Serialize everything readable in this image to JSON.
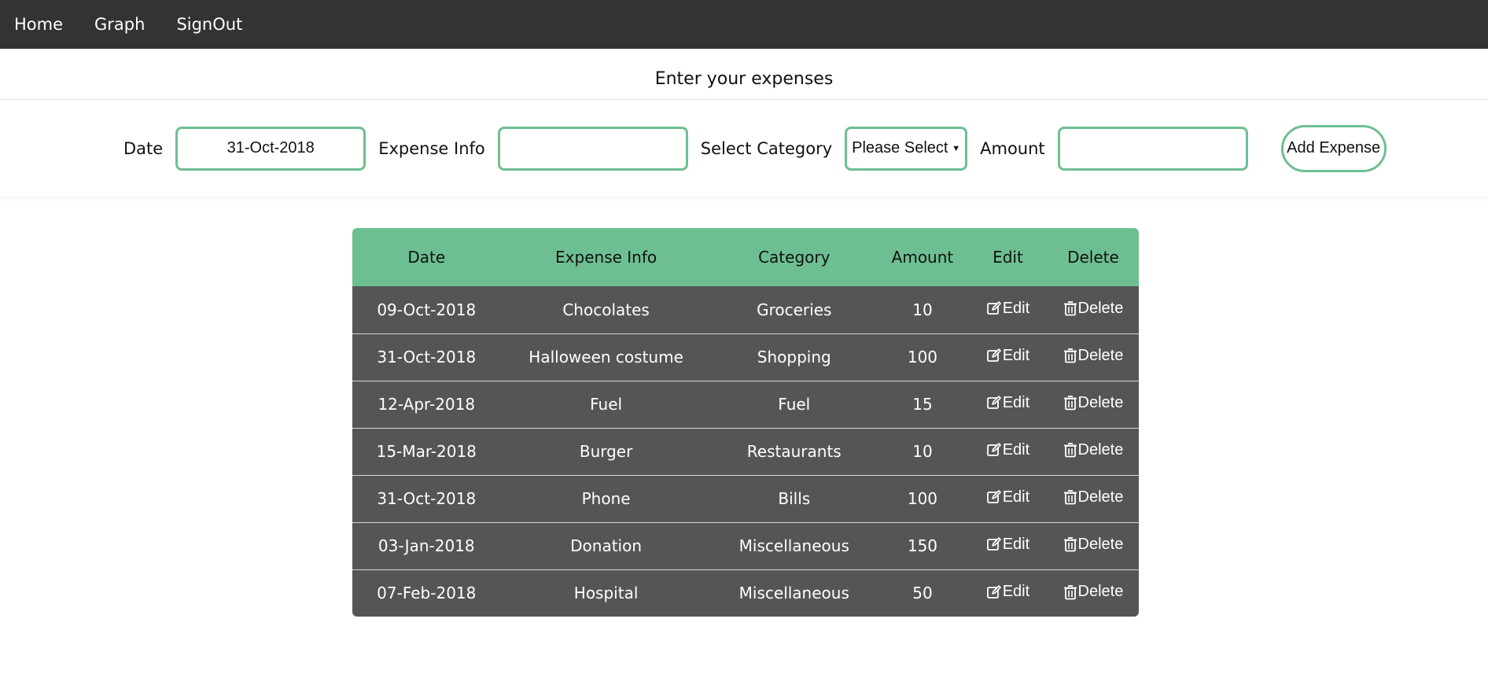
{
  "nav": {
    "items": [
      {
        "label": "Home"
      },
      {
        "label": "Graph"
      },
      {
        "label": "SignOut"
      }
    ]
  },
  "page": {
    "title": "Enter your expenses"
  },
  "form": {
    "date_label": "Date",
    "date_value": "31-Oct-2018",
    "info_label": "Expense Info",
    "info_value": "",
    "category_label": "Select Category",
    "category_selected": "Please Select",
    "amount_label": "Amount",
    "amount_value": "",
    "add_button": "Add Expense"
  },
  "table": {
    "headers": [
      "Date",
      "Expense Info",
      "Category",
      "Amount",
      "Edit",
      "Delete"
    ],
    "edit_label": "Edit",
    "delete_label": "Delete",
    "edit_icon": "edit-icon",
    "delete_icon": "trash-icon",
    "rows": [
      {
        "date": "09-Oct-2018",
        "info": "Chocolates",
        "category": "Groceries",
        "amount": "10"
      },
      {
        "date": "31-Oct-2018",
        "info": "Halloween costume",
        "category": "Shopping",
        "amount": "100"
      },
      {
        "date": "12-Apr-2018",
        "info": "Fuel",
        "category": "Fuel",
        "amount": "15"
      },
      {
        "date": "15-Mar-2018",
        "info": "Burger",
        "category": "Restaurants",
        "amount": "10"
      },
      {
        "date": "31-Oct-2018",
        "info": "Phone",
        "category": "Bills",
        "amount": "100"
      },
      {
        "date": "03-Jan-2018",
        "info": "Donation",
        "category": "Miscellaneous",
        "amount": "150"
      },
      {
        "date": "07-Feb-2018",
        "info": "Hospital",
        "category": "Miscellaneous",
        "amount": "50"
      }
    ]
  },
  "colors": {
    "navbar": "#333333",
    "accent": "#6dbf91",
    "row_bg": "#555555"
  }
}
